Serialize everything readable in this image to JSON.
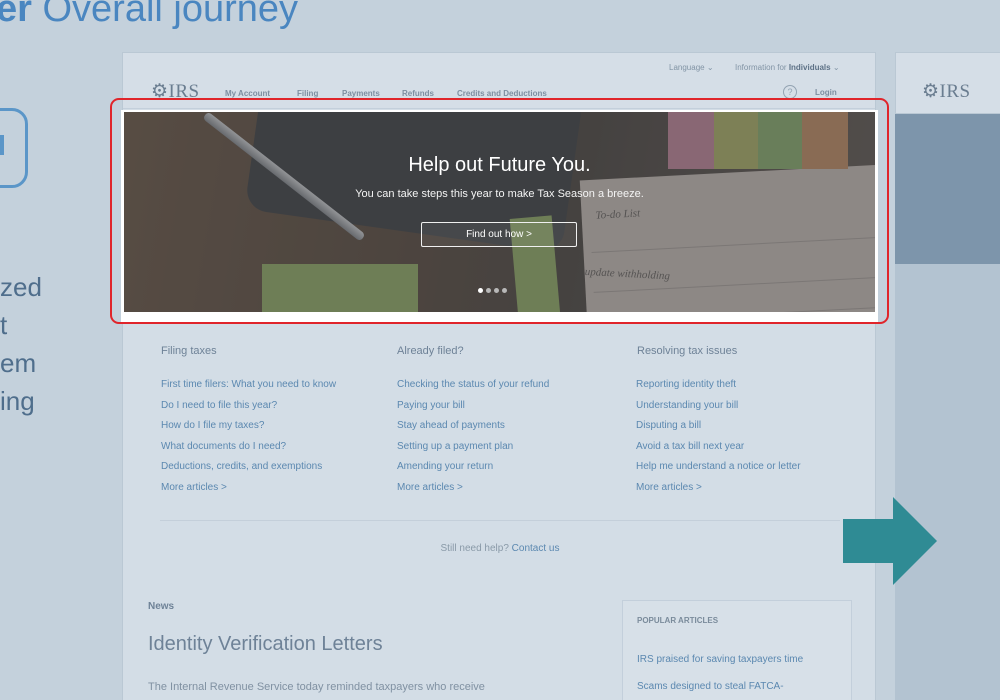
{
  "slide": {
    "title_bold": "er",
    "title_rest": " Overall journey",
    "left_text": [
      "zed",
      "t",
      "em",
      "ing"
    ]
  },
  "header": {
    "logo": "IRS",
    "language_label": "Language",
    "info_for_label": "Information for",
    "info_for_value": "Individuals",
    "nav": [
      "My Account",
      "Filing",
      "Payments",
      "Refunds",
      "Credits and Deductions"
    ],
    "help_icon_glyph": "?",
    "login_label": "Login"
  },
  "hero": {
    "title": "Help out Future You.",
    "subtitle": "You can take steps this year to make Tax Season a breeze.",
    "button_label": "Find out how >",
    "note_todo": "To-do List",
    "note_update": "update withholding",
    "slide_count": 4,
    "active_slide": 1
  },
  "columns": [
    {
      "heading": "Filing taxes",
      "links": [
        "First time filers: What you need to know",
        "Do I need to file this year?",
        "How do I file my taxes?",
        "What documents do I need?",
        "Deductions, credits, and exemptions",
        "More articles >"
      ]
    },
    {
      "heading": "Already filed?",
      "links": [
        "Checking the status of your refund",
        "Paying your bill",
        "Stay ahead of payments",
        "Setting up a payment plan",
        "Amending your return",
        "More articles >"
      ]
    },
    {
      "heading": "Resolving tax issues",
      "links": [
        "Reporting identity theft",
        "Understanding your bill",
        "Disputing a bill",
        "Avoid a tax bill next year",
        "Help me understand a notice or letter",
        "More articles >"
      ]
    }
  ],
  "help": {
    "text": "Still need help?",
    "link": "Contact us"
  },
  "news": {
    "label": "News",
    "title": "Identity Verification Letters",
    "body": "The Internal Revenue Service today reminded taxpayers who receive"
  },
  "popular": {
    "heading": "POPULAR ARTICLES",
    "links": [
      "IRS praised for saving taxpayers time",
      "Scams designed to steal FATCA-"
    ]
  },
  "right_panel": {
    "logo": "IRS"
  },
  "colors": {
    "highlight": "#e0252b",
    "arrow": "#2f8b94",
    "link": "#5b88b0",
    "title_blue": "#4a86c0"
  }
}
